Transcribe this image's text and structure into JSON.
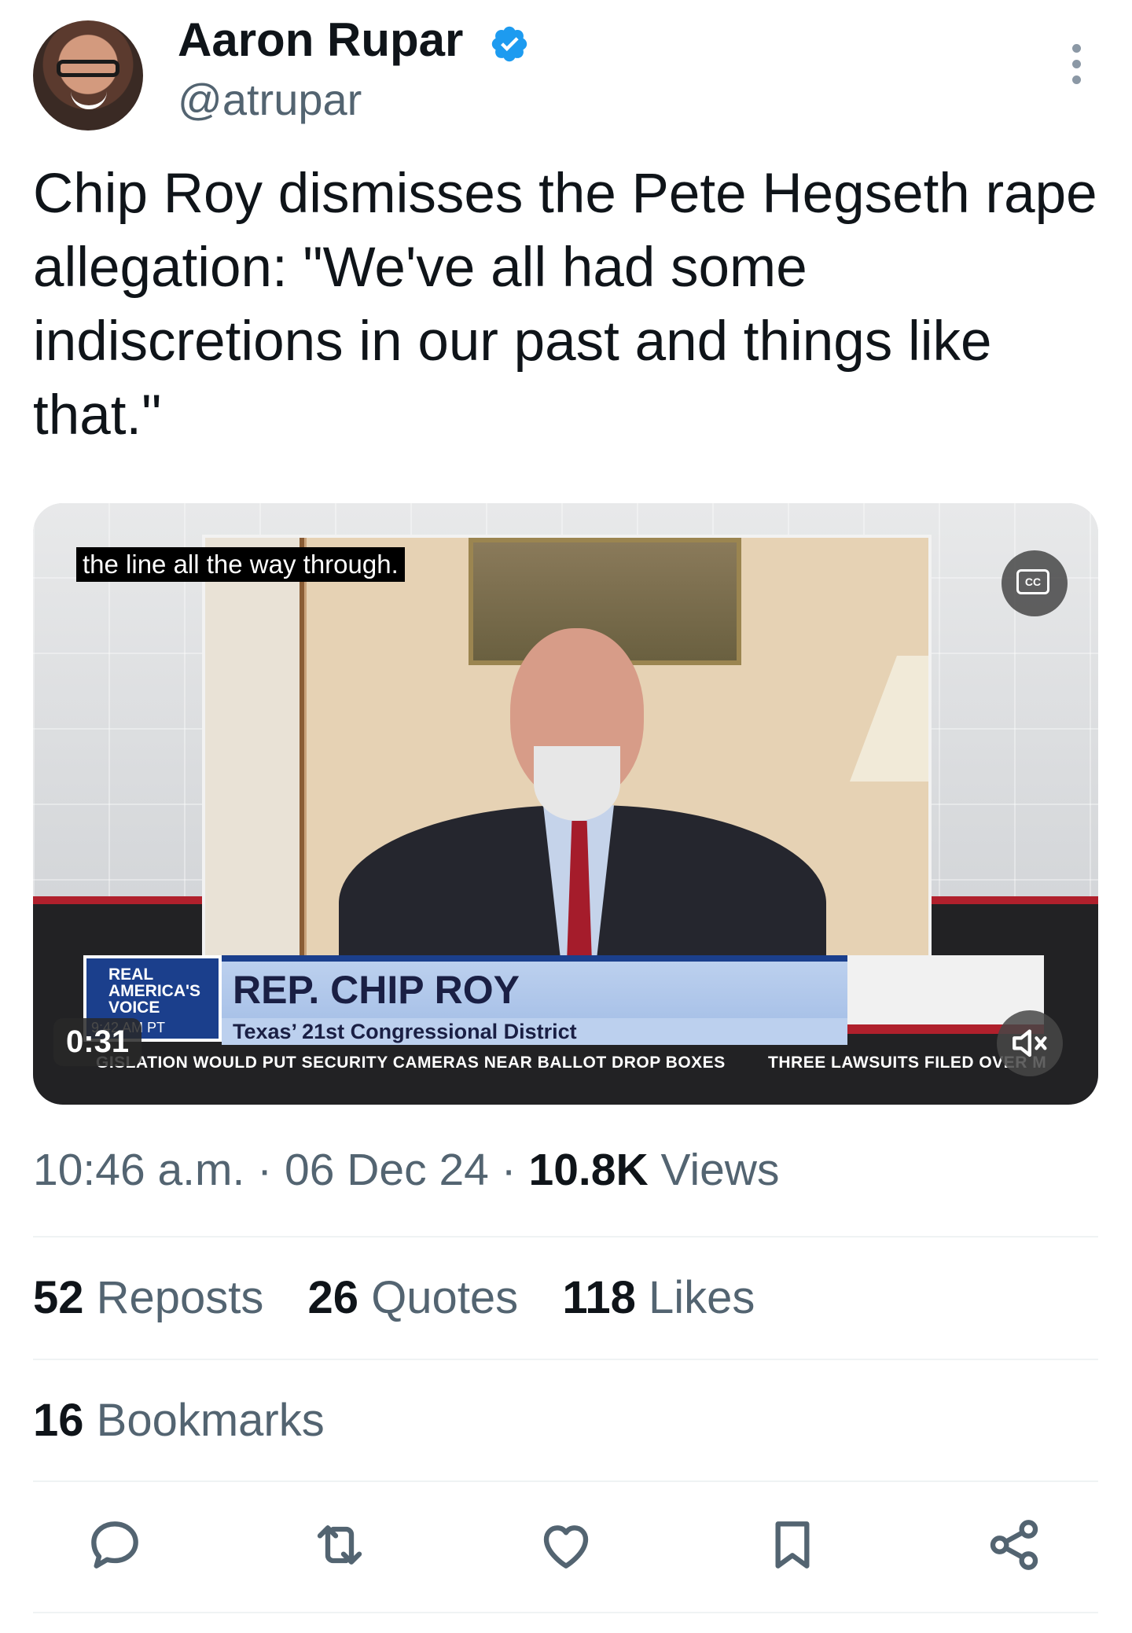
{
  "author": {
    "name": "Aaron Rupar",
    "handle": "@atrupar",
    "verified": true,
    "avatar_icon": "avatar"
  },
  "tweet": {
    "text": "Chip Roy dismisses the Pete Hegseth rape allegation: \"We've all had some indiscretions in our past and things like that.\""
  },
  "video": {
    "caption": "the line all the way through.",
    "duration": "0:31",
    "cc_label": "CC",
    "lower_third": {
      "brand_line1": "REAL",
      "brand_line2": "AMERICA'S",
      "brand_line3": "VOICE",
      "time": "9:42 AM PT",
      "name": "REP. CHIP ROY",
      "district": "Texas’ 21st Congressional District"
    },
    "crawl": [
      "GISLATION WOULD PUT SECURITY CAMERAS NEAR BALLOT DROP BOXES",
      "THREE LAWSUITS FILED OVER M"
    ]
  },
  "meta": {
    "time": "10:46 a.m.",
    "sep": " · ",
    "date": "06 Dec 24",
    "views_count": "10.8K",
    "views_label": "Views"
  },
  "stats": {
    "reposts_count": "52",
    "reposts_label": "Reposts",
    "quotes_count": "26",
    "quotes_label": "Quotes",
    "likes_count": "118",
    "likes_label": "Likes",
    "bookmarks_count": "16",
    "bookmarks_label": "Bookmarks"
  },
  "colors": {
    "text": "#0f1419",
    "secondary": "#536471",
    "verified": "#1d9bf0",
    "divider": "#eff3f4"
  },
  "icons": [
    "reply-icon",
    "repost-icon",
    "like-icon",
    "bookmark-icon",
    "share-icon",
    "more-icon",
    "verified-icon",
    "cc-icon",
    "mute-icon"
  ]
}
